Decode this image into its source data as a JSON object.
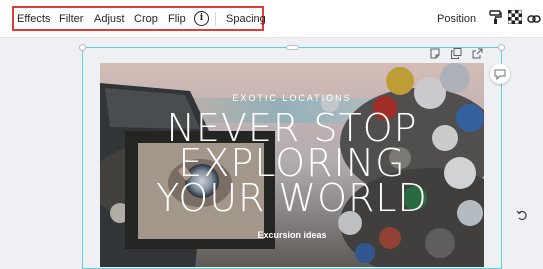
{
  "toolbar": {
    "items": [
      "Effects",
      "Filter",
      "Adjust",
      "Crop",
      "Flip"
    ],
    "info_icon": "info-icon",
    "spacing_label": "Spacing",
    "position_label": "Position",
    "right_icons": [
      "paint-roller-icon",
      "transparency-icon",
      "link-icon"
    ],
    "highlight_color": "#e53935"
  },
  "canvas": {
    "page_actions": [
      "note-icon",
      "duplicate-page-icon",
      "share-page-icon"
    ],
    "comment_icon": "comment-icon",
    "rotate_icon": "rotate-icon",
    "selection_color": "#5ad0dc"
  },
  "artwork": {
    "kicker": "EXOTIC LOCATIONS",
    "headline": [
      "NEVER STOP",
      "EXPLORING",
      "YOUR WORLD"
    ],
    "caption": "Excursion ideas"
  }
}
